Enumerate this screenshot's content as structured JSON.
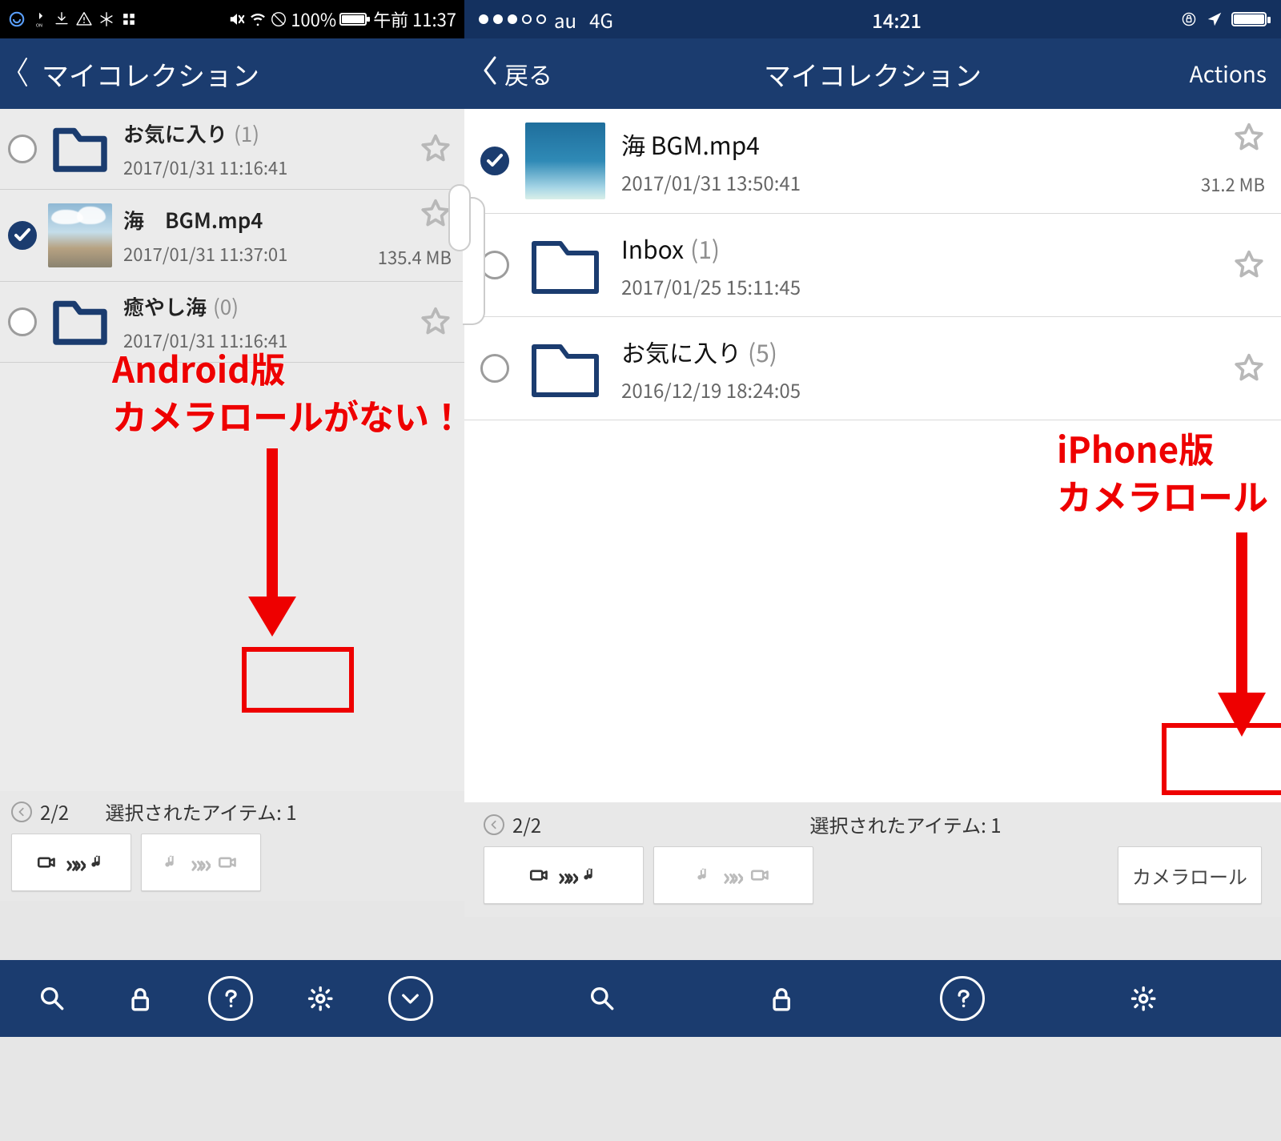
{
  "left": {
    "status": {
      "battery_text": "100%",
      "time_text": "午前 11:37"
    },
    "nav": {
      "title": "マイコレクション"
    },
    "rows": [
      {
        "name": "お気に入り",
        "count": "(1)",
        "ts": "2017/01/31 11:16:41",
        "selected": false,
        "kind": "folder",
        "size": ""
      },
      {
        "name": "海　BGM.mp4",
        "count": "",
        "ts": "2017/01/31 11:37:01",
        "selected": true,
        "kind": "video",
        "size": "135.4 MB"
      },
      {
        "name": "癒やし海",
        "count": "(0)",
        "ts": "2017/01/31 11:16:41",
        "selected": false,
        "kind": "folder",
        "size": ""
      }
    ],
    "annot": {
      "line1": "Android版",
      "line2": "カメラロールがない！"
    },
    "strip": {
      "page": "2/2",
      "selected_text": "選択されたアイテム: 1",
      "camroll_label": ""
    }
  },
  "right": {
    "status": {
      "carrier": "au",
      "net": "4G",
      "time": "14:21"
    },
    "nav": {
      "back": "戻る",
      "title": "マイコレクション",
      "actions": "Actions"
    },
    "rows": [
      {
        "name": "海 BGM.mp4",
        "count": "",
        "ts": "2017/01/31 13:50:41",
        "size": "31.2 MB",
        "selected": true,
        "kind": "video"
      },
      {
        "name": "Inbox",
        "count": "(1)",
        "ts": "2017/01/25 15:11:45",
        "size": "",
        "selected": false,
        "kind": "folder"
      },
      {
        "name": "お気に入り",
        "count": "(5)",
        "ts": "2016/12/19 18:24:05",
        "size": "",
        "selected": false,
        "kind": "folder"
      }
    ],
    "annot": {
      "line1": "iPhone版",
      "line2": "カメラロール"
    },
    "strip": {
      "page": "2/2",
      "selected_text": "選択されたアイテム: 1",
      "camroll_label": "カメラロール"
    }
  }
}
